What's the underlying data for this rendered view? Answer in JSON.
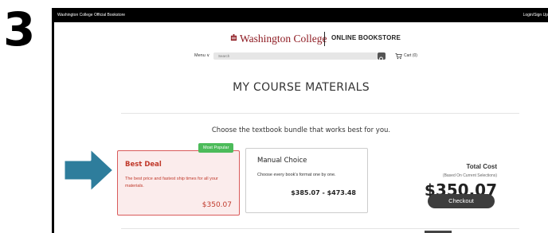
{
  "step_number": "3",
  "topbar": {
    "store_name": "Washington College Official Bookstore",
    "login": "Login/Sign Up"
  },
  "header": {
    "college_name": "Washington College",
    "bookstore_label": "ONLINE BOOKSTORE",
    "menu_label": "Menu ∨",
    "search_placeholder": "Search",
    "cart_label": "Cart (0)"
  },
  "main": {
    "title": "MY COURSE MATERIALS",
    "subtitle": "Choose the textbook bundle that works best for you.",
    "options": [
      {
        "badge": "Most Popular",
        "title": "Best Deal",
        "description": "The best price and fastest ship times for all your materials.",
        "price": "$350.07"
      },
      {
        "title": "Manual Choice",
        "description": "Choose every book's format one by one.",
        "price": "$385.07 - $473.48"
      }
    ],
    "total": {
      "label": "Total Cost",
      "note": "(Based On Current Selections)",
      "amount": "$350.07",
      "checkout_label": "Checkout"
    }
  },
  "colors": {
    "brand": "#8e1b22",
    "best_deal_red": "#c0392b",
    "badge_green": "#4cbb5a",
    "arrow_blue": "#2e7d9c",
    "button_dark": "#3d3d3d"
  },
  "icons": {
    "seal": "college-seal-icon",
    "search": "search-icon",
    "cart": "cart-icon",
    "arrow": "arrow-right-icon"
  }
}
